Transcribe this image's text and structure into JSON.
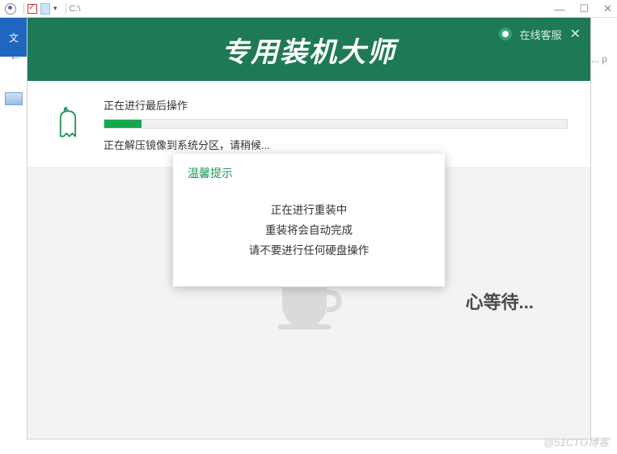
{
  "chrome": {
    "path": "C:\\",
    "file_menu": "文",
    "min": "—",
    "max": "☐",
    "close": "✕",
    "search_suffix": "... ρ",
    "drop": "▾"
  },
  "app": {
    "title": "专用装机大师",
    "header": {
      "customer_service": "在线客服",
      "close": "✕"
    },
    "progress": {
      "label": "正在进行最后操作",
      "status": "正在解压镜像到系统分区，请稍候...",
      "percent": 8
    },
    "waiting_text": "心等待...",
    "tip": {
      "title": "温馨提示",
      "line1": "正在进行重装中",
      "line2": "重装将会自动完成",
      "line3": "请不要进行任何硬盘操作"
    }
  },
  "watermark": "@51CTO博客"
}
